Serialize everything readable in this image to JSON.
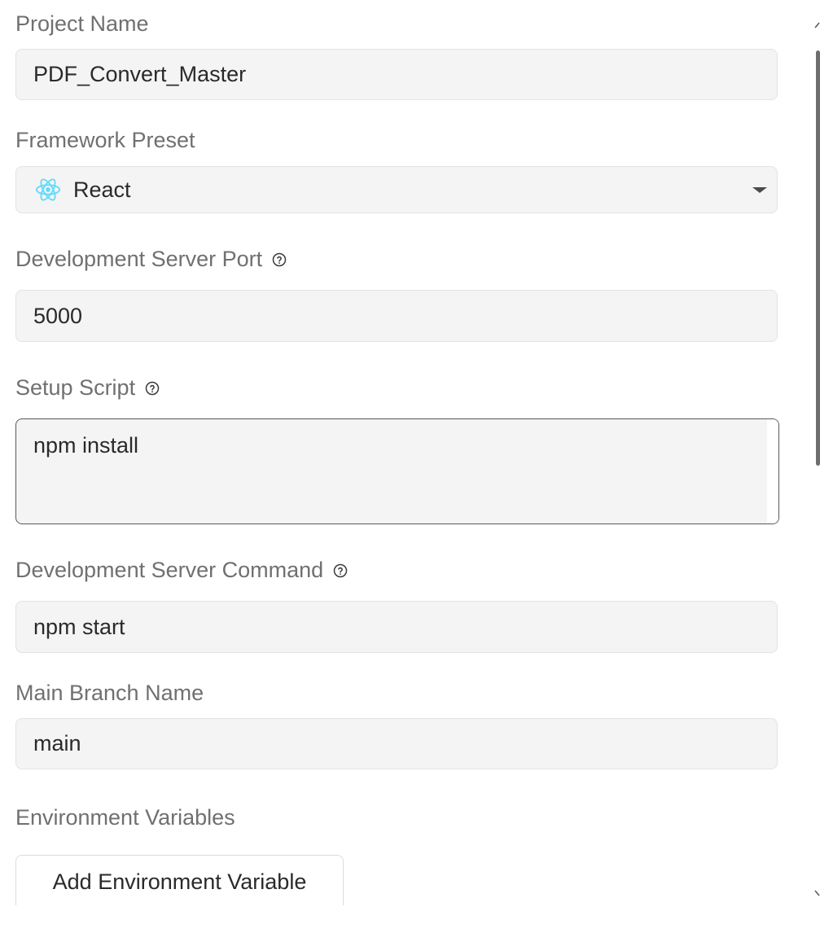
{
  "project_name": {
    "label": "Project Name",
    "value": "PDF_Convert_Master"
  },
  "framework_preset": {
    "label": "Framework Preset",
    "value": "React",
    "icon": "react-icon",
    "icon_color": "#61DAFB"
  },
  "dev_server_port": {
    "label": "Development Server Port",
    "value": "5000",
    "help_icon": "help-circle-icon"
  },
  "setup_script": {
    "label": "Setup Script",
    "value": "npm install",
    "help_icon": "help-circle-icon"
  },
  "dev_server_command": {
    "label": "Development Server Command",
    "value": "npm start",
    "help_icon": "help-circle-icon"
  },
  "main_branch": {
    "label": "Main Branch Name",
    "value": "main"
  },
  "env_vars": {
    "label": "Environment Variables",
    "add_button": "Add Environment Variable"
  }
}
